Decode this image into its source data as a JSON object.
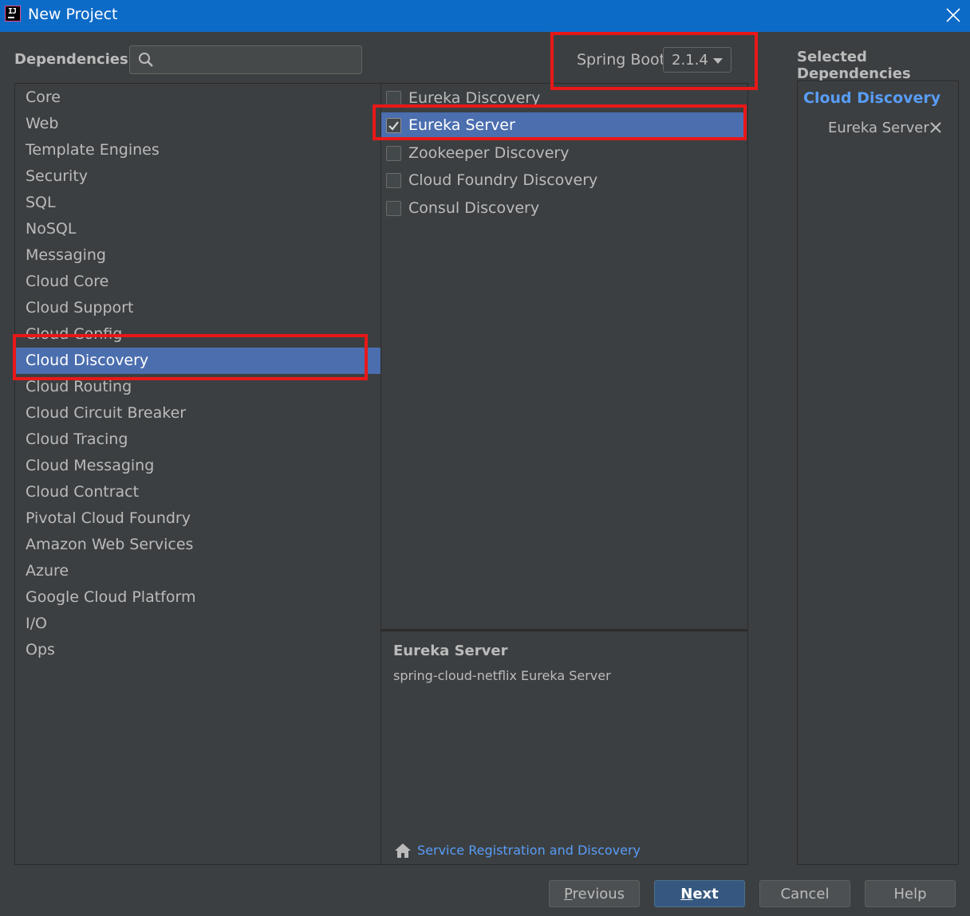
{
  "window": {
    "title": "New Project",
    "app_icon_text": "IJ"
  },
  "header": {
    "dependencies_label": "Dependencies",
    "search_placeholder": "",
    "spring_boot_label": "Spring Boot",
    "spring_boot_version": "2.1.4",
    "selected_title": "Selected Dependencies"
  },
  "categories": [
    {
      "label": "Core"
    },
    {
      "label": "Web"
    },
    {
      "label": "Template Engines"
    },
    {
      "label": "Security"
    },
    {
      "label": "SQL"
    },
    {
      "label": "NoSQL"
    },
    {
      "label": "Messaging"
    },
    {
      "label": "Cloud Core"
    },
    {
      "label": "Cloud Support"
    },
    {
      "label": "Cloud Config"
    },
    {
      "label": "Cloud Discovery",
      "selected": true
    },
    {
      "label": "Cloud Routing"
    },
    {
      "label": "Cloud Circuit Breaker"
    },
    {
      "label": "Cloud Tracing"
    },
    {
      "label": "Cloud Messaging"
    },
    {
      "label": "Cloud Contract"
    },
    {
      "label": "Pivotal Cloud Foundry"
    },
    {
      "label": "Amazon Web Services"
    },
    {
      "label": "Azure"
    },
    {
      "label": "Google Cloud Platform"
    },
    {
      "label": "I/O"
    },
    {
      "label": "Ops"
    }
  ],
  "dependencies": [
    {
      "label": "Eureka Discovery",
      "checked": false
    },
    {
      "label": "Eureka Server",
      "checked": true,
      "selected": true
    },
    {
      "label": "Zookeeper Discovery",
      "checked": false
    },
    {
      "label": "Cloud Foundry Discovery",
      "checked": false
    },
    {
      "label": "Consul Discovery",
      "checked": false
    }
  ],
  "description": {
    "title": "Eureka Server",
    "text": "spring-cloud-netflix Eureka Server",
    "link_text": "Service Registration and Discovery"
  },
  "selected": {
    "group": "Cloud Discovery",
    "items": [
      "Eureka Server"
    ]
  },
  "buttons": {
    "previous_mnemonic": "P",
    "previous_rest": "revious",
    "next_mnemonic": "N",
    "next_rest": "ext",
    "cancel": "Cancel",
    "help": "Help"
  },
  "colors": {
    "titlebar": "#0d6bc8",
    "background": "#3c3f41",
    "selection": "#4b6eaf",
    "link": "#589df6",
    "highlight_box": "#e81818"
  }
}
